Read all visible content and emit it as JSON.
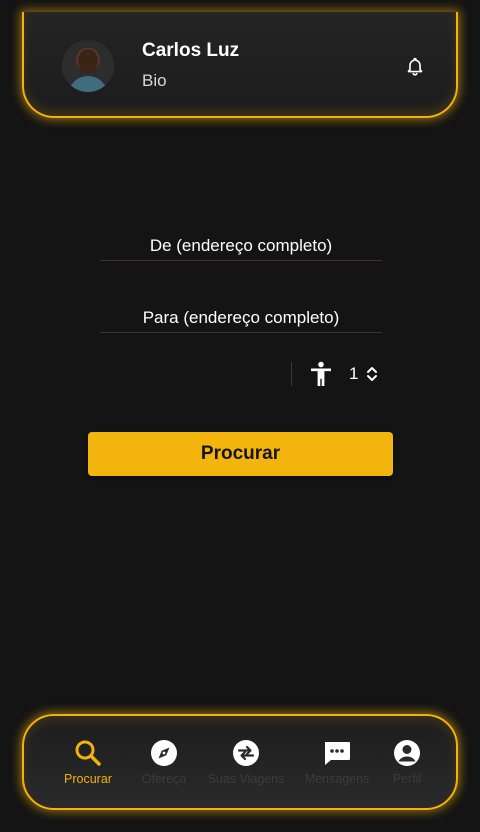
{
  "profile": {
    "name": "Carlos Luz",
    "bio": "Bio"
  },
  "form": {
    "from_placeholder": "De (endereço completo)",
    "to_placeholder": "Para (endereço completo)",
    "passengers": "1",
    "search_label": "Procurar"
  },
  "nav": {
    "items": [
      {
        "label": "Procurar",
        "icon": "search-icon",
        "active": true
      },
      {
        "label": "Ofereça",
        "icon": "compass-icon",
        "active": false
      },
      {
        "label": "Suas Viagens",
        "icon": "swap-icon",
        "active": false
      },
      {
        "label": "Mensagens",
        "icon": "message-icon",
        "active": false
      },
      {
        "label": "Perfil",
        "icon": "account-icon",
        "active": false
      }
    ]
  },
  "colors": {
    "accent": "#f3b10c",
    "background": "#141414"
  }
}
